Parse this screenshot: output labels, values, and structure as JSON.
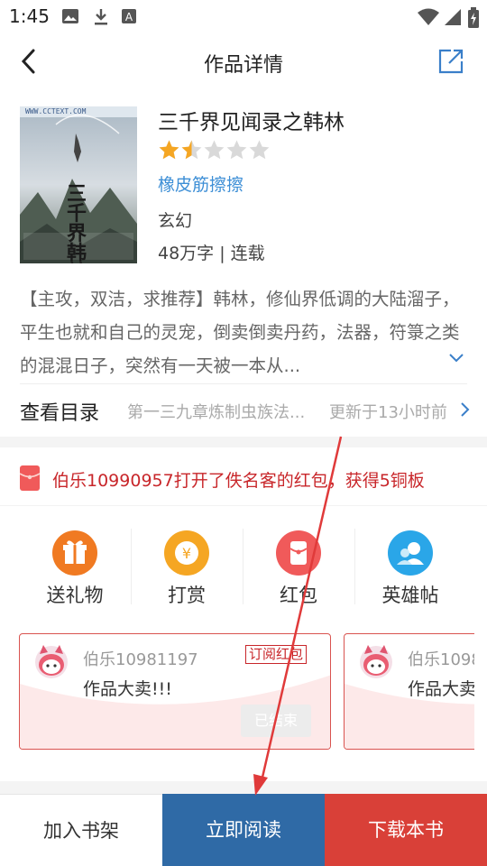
{
  "status_bar": {
    "time": "1:45",
    "icons": [
      "image-icon",
      "download-icon",
      "a-badge-icon",
      "wifi-icon",
      "signal-icon",
      "battery-icon"
    ]
  },
  "nav": {
    "title": "作品详情",
    "back_icon": "back-arrow-icon",
    "share_icon": "share-icon"
  },
  "book": {
    "cover_text": "三千界韩林",
    "cover_banner": "WWW.CCTEXT.COM",
    "title": "三千界见闻录之韩林",
    "rating": 1.5,
    "rating_max": 5,
    "author": "橡皮筋擦擦",
    "genre": "玄幻",
    "stats": "48万字 | 连载",
    "description": "【主攻，双洁，求推荐】韩林，修仙界低调的大陆溜子，平生也就和自己的灵宠，倒卖倒卖丹药，法器，符箓之类的混混日子，突然有一天被一本从..."
  },
  "toc": {
    "label": "查看目录",
    "latest_chapter": "第一三九章炼制虫族法...",
    "updated": "更新于13小时前"
  },
  "notice": {
    "text": "伯乐10990957打开了佚名客的红包，获得5铜板"
  },
  "actions": [
    {
      "label": "送礼物",
      "icon": "gift-icon",
      "color": "#f07a22"
    },
    {
      "label": "打赏",
      "icon": "yuan-coin-icon",
      "color": "#f5a623"
    },
    {
      "label": "红包",
      "icon": "red-packet-icon",
      "color": "#f05a5a"
    },
    {
      "label": "英雄帖",
      "icon": "users-icon",
      "color": "#2aa6e8"
    }
  ],
  "cards": [
    {
      "name": "伯乐10981197",
      "badge": "订阅红包",
      "message": "作品大卖!!!",
      "status": "已结束"
    },
    {
      "name": "伯乐1098",
      "message": "作品大卖"
    }
  ],
  "bottom": {
    "add_shelf": "加入书架",
    "read_now": "立即阅读",
    "download": "下载本书"
  }
}
